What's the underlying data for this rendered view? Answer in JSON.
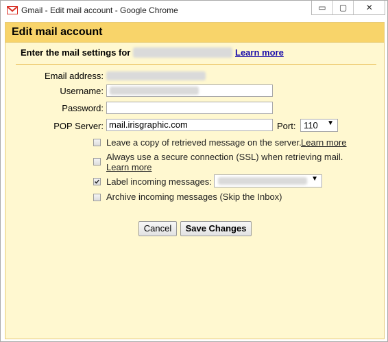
{
  "window": {
    "title": "Gmail - Edit mail account - Google Chrome",
    "controls": {
      "minimize": "▭",
      "maximize": "▢",
      "close": "✕"
    }
  },
  "dialog": {
    "title": "Edit mail account",
    "instruction": "Enter the mail settings for",
    "learn_more": "Learn more"
  },
  "form": {
    "email_label": "Email address:",
    "username_label": "Username:",
    "password_label": "Password:",
    "pop_server_label": "POP Server:",
    "pop_server_value": "mail.irisgraphic.com",
    "port_label": "Port:",
    "port_value": "110"
  },
  "options": {
    "leave_copy": {
      "label": "Leave a copy of retrieved message on the server.",
      "link": "Learn more",
      "checked": false
    },
    "ssl": {
      "label": "Always use a secure connection (SSL) when retrieving mail.",
      "link": "Learn more",
      "checked": false
    },
    "label_incoming": {
      "label": "Label incoming messages:",
      "checked": true
    },
    "archive": {
      "label": "Archive incoming messages (Skip the Inbox)",
      "checked": false
    }
  },
  "buttons": {
    "cancel": "Cancel",
    "save": "Save Changes"
  },
  "colors": {
    "header": "#f8d46a",
    "panel": "#fff8d0",
    "link": "#1a0dab"
  }
}
